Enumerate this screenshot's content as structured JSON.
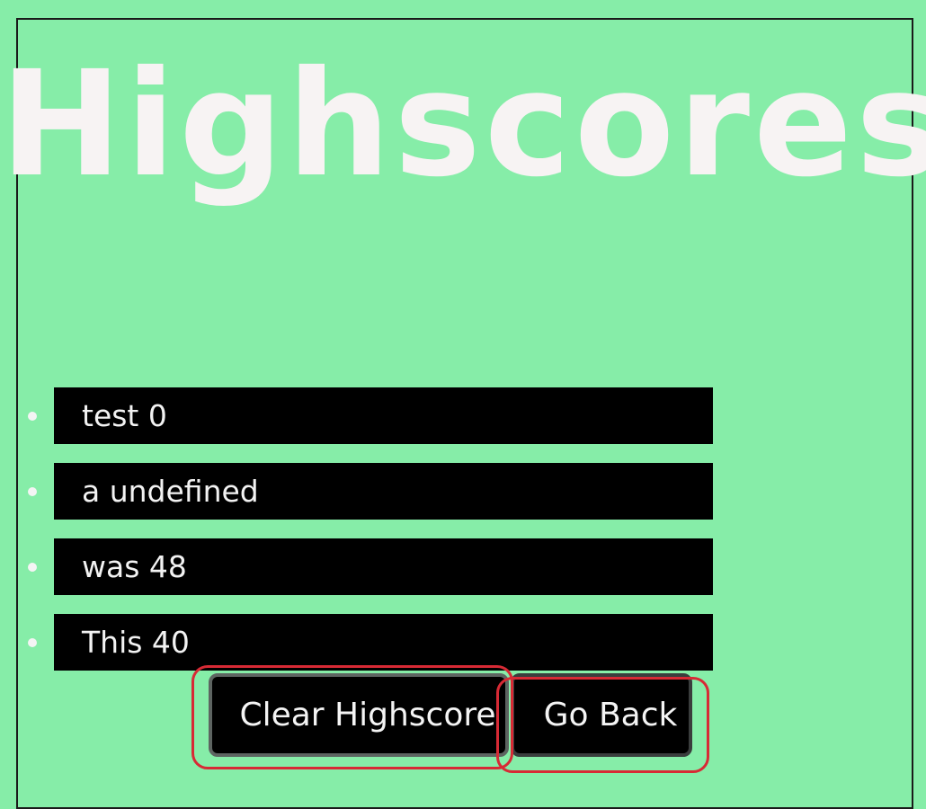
{
  "page": {
    "title": "Highscores"
  },
  "highscores": [
    {
      "label": "test 0"
    },
    {
      "label": "a undefined"
    },
    {
      "label": "was 48"
    },
    {
      "label": "This 40"
    }
  ],
  "buttons": {
    "clear_label": "Clear Highscore",
    "back_label": "Go Back"
  },
  "colors": {
    "background": "#86eda8",
    "title_text": "#f7f3f3",
    "row_background": "#000000",
    "highlight_ring": "#d72a35"
  }
}
